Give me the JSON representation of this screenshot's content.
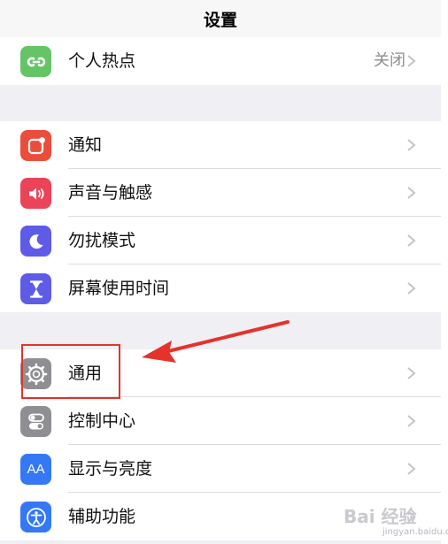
{
  "header": {
    "title": "设置"
  },
  "groups": [
    {
      "items": [
        {
          "label": "个人热点",
          "value": "关闭",
          "icon": "hotspot-icon",
          "color": "#65c466"
        }
      ]
    },
    {
      "items": [
        {
          "label": "通知",
          "icon": "notifications-icon",
          "color": "#eb4d3d"
        },
        {
          "label": "声音与触感",
          "icon": "sound-icon",
          "color": "#eb445a"
        },
        {
          "label": "勿扰模式",
          "icon": "moon-icon",
          "color": "#5e5ce6"
        },
        {
          "label": "屏幕使用时间",
          "icon": "hourglass-icon",
          "color": "#5e5ce6"
        }
      ]
    },
    {
      "items": [
        {
          "label": "通用",
          "icon": "gear-icon",
          "color": "#8e8e93"
        },
        {
          "label": "控制中心",
          "icon": "toggles-icon",
          "color": "#8e8e93"
        },
        {
          "label": "显示与亮度",
          "icon": "display-icon",
          "color": "#3478f6",
          "icon_text": "AA"
        },
        {
          "label": "辅助功能",
          "icon": "accessibility-icon",
          "color": "#3478f6"
        }
      ]
    }
  ],
  "annotation": {
    "color": "#e5322b"
  },
  "watermark": {
    "main": "Bai 经验",
    "sub": "jingyan.baidu.com"
  }
}
